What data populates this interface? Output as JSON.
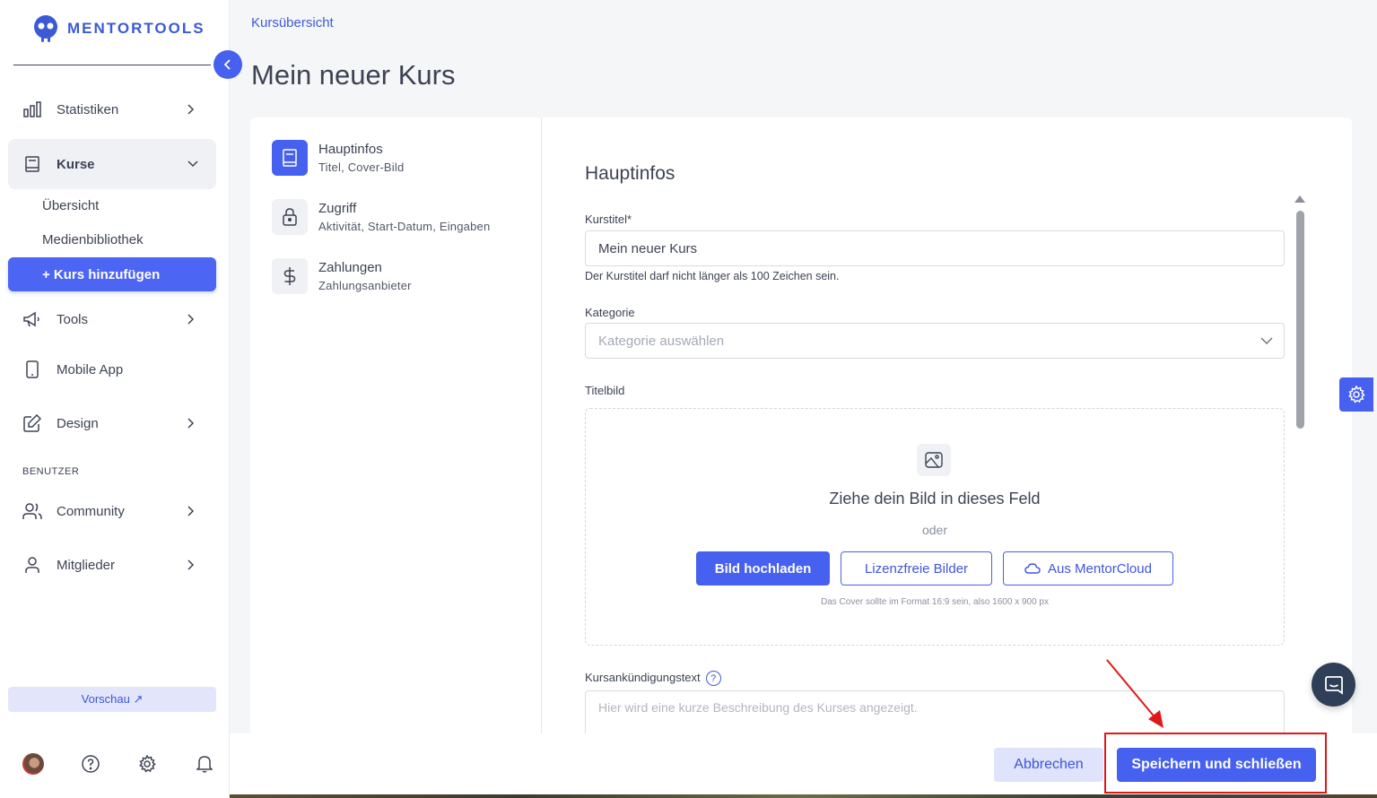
{
  "brand": {
    "name": "MENTORTOOLS"
  },
  "sidebar": {
    "items": [
      {
        "label": "Statistiken",
        "icon": "bar-chart-icon"
      },
      {
        "label": "Kurse",
        "icon": "book-icon"
      },
      {
        "label": "Tools",
        "icon": "megaphone-icon"
      },
      {
        "label": "Mobile App",
        "icon": "smartphone-icon"
      },
      {
        "label": "Design",
        "icon": "edit-icon"
      },
      {
        "label": "Community",
        "icon": "users-icon"
      },
      {
        "label": "Mitglieder",
        "icon": "user-icon"
      }
    ],
    "kurse_sub": [
      "Übersicht",
      "Medienbibliothek"
    ],
    "add_course": "+ Kurs hinzufügen",
    "section_users": "BENUTZER",
    "preview": "Vorschau ↗"
  },
  "header": {
    "breadcrumb": "Kursübersicht",
    "title": "Mein neuer Kurs"
  },
  "steps": [
    {
      "title": "Hauptinfos",
      "subtitle": "Titel, Cover-Bild",
      "icon": "book-icon",
      "active": true
    },
    {
      "title": "Zugriff",
      "subtitle": "Aktivität, Start-Datum, Eingaben",
      "icon": "lock-icon",
      "active": false
    },
    {
      "title": "Zahlungen",
      "subtitle": "Zahlungsanbieter",
      "icon": "dollar-icon",
      "active": false
    }
  ],
  "form": {
    "title": "Hauptinfos",
    "course_title_label": "Kurstitel*",
    "course_title_value": "Mein neuer Kurs",
    "course_title_hint": "Der Kurstitel darf nicht länger als 100 Zeichen sein.",
    "category_label": "Kategorie",
    "category_placeholder": "Kategorie auswählen",
    "cover_label": "Titelbild",
    "dropzone_title": "Ziehe dein Bild in dieses Feld",
    "dropzone_or": "oder",
    "upload_button": "Bild hochladen",
    "free_images_button": "Lizenzfreie Bilder",
    "mentorcloud_button": "Aus MentorCloud",
    "cover_note": "Das Cover sollte im Format 16:9 sein, also 1600 x 900 px",
    "announcement_label": "Kursankündigungstext",
    "announcement_placeholder": "Hier wird eine kurze Beschreibung des Kurses angezeigt."
  },
  "footer": {
    "cancel": "Abbrechen",
    "save": "Speichern und schließen"
  },
  "colors": {
    "accent": "#4660f0",
    "annotation": "#e01818"
  }
}
